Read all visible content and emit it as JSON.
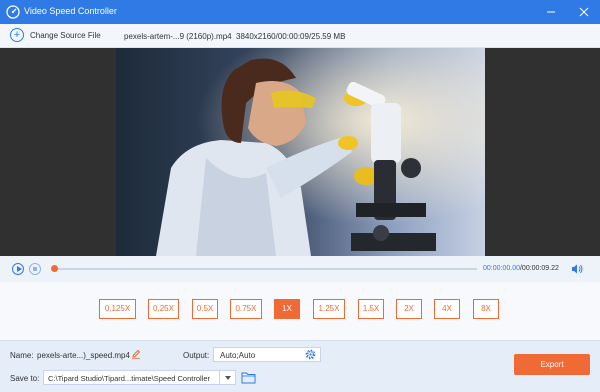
{
  "window": {
    "title": "Video Speed Controller",
    "minimize_icon": "minimize-icon",
    "close_icon": "close-icon"
  },
  "source": {
    "change_label": "Change Source File",
    "file_name": "pexels-artem-...9 (2160p).mp4",
    "file_info": "3840x2160/00:00:09/25.59 MB"
  },
  "player": {
    "current_time": "00:00:00.00",
    "total_time": "/00:00:09.22",
    "progress": 0.0
  },
  "speeds": [
    "0.125X",
    "0.25X",
    "0.5X",
    "0.75X",
    "1X",
    "1.25X",
    "1.5X",
    "2X",
    "4X",
    "8X"
  ],
  "selected_speed": "1X",
  "bottom": {
    "name_label": "Name:",
    "name_value": "pexels-arte...)_speed.mp4",
    "output_label": "Output:",
    "output_value": "Auto;Auto",
    "save_label": "Save to:",
    "save_value": "C:\\Tipard Studio\\Tipard...timate\\Speed Controller",
    "export_label": "Export"
  },
  "colors": {
    "accent": "#2f7ae5",
    "orange": "#f06a35"
  }
}
